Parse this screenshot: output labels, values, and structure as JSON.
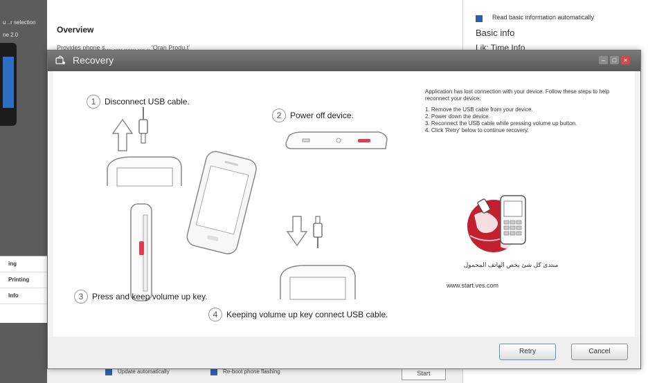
{
  "background": {
    "sidebar": {
      "items": [
        "u ..r selection",
        "ne 2.0"
      ],
      "list": [
        "ing",
        "Printing",
        "Info"
      ]
    },
    "main": {
      "overview_title": "Overview",
      "overview_desc": "Provides phone s..., ..... ....... .... .. 'Oran Produ.t'"
    },
    "right_panel": {
      "checkbox_label": "Read basic information automatically",
      "basic_info": "Basic info",
      "line2": "Lik: Time Info"
    },
    "bottom": {
      "cb1_label": "Update automatically",
      "cb2_label": "Re-boot phone flashing",
      "start_label": "Start"
    }
  },
  "dialog": {
    "title": "Recovery",
    "steps": [
      {
        "num": "1",
        "text": "Disconnect USB cable."
      },
      {
        "num": "2",
        "text": "Power off device."
      },
      {
        "num": "3",
        "text": "Press and keep volume up key."
      },
      {
        "num": "4",
        "text": "Keeping volume up key connect USB cable."
      }
    ],
    "info": {
      "intro": "Application has lost connection with your device. Follow these steps to help reconnect your device:",
      "steps": [
        "1. Remove the USB cable from your device.",
        "2. Power down the device.",
        "3. Reconnect the USB cable while pressing volume up button.",
        "4. Click 'Retry' below to continue recovery."
      ]
    },
    "logo_text": "منتدى كل شئ يخص الهاتف المحمول",
    "site": "www.start.ves.com",
    "buttons": {
      "retry": "Retry",
      "cancel": "Cancel"
    }
  },
  "colors": {
    "titlebar": "#6a6a6a",
    "accent": "#2f5fa8",
    "highlight": "#e03c4f",
    "logo_red": "#c2202f"
  },
  "icons": [
    "recovery-icon",
    "minimize-icon",
    "maximize-icon",
    "close-icon"
  ]
}
